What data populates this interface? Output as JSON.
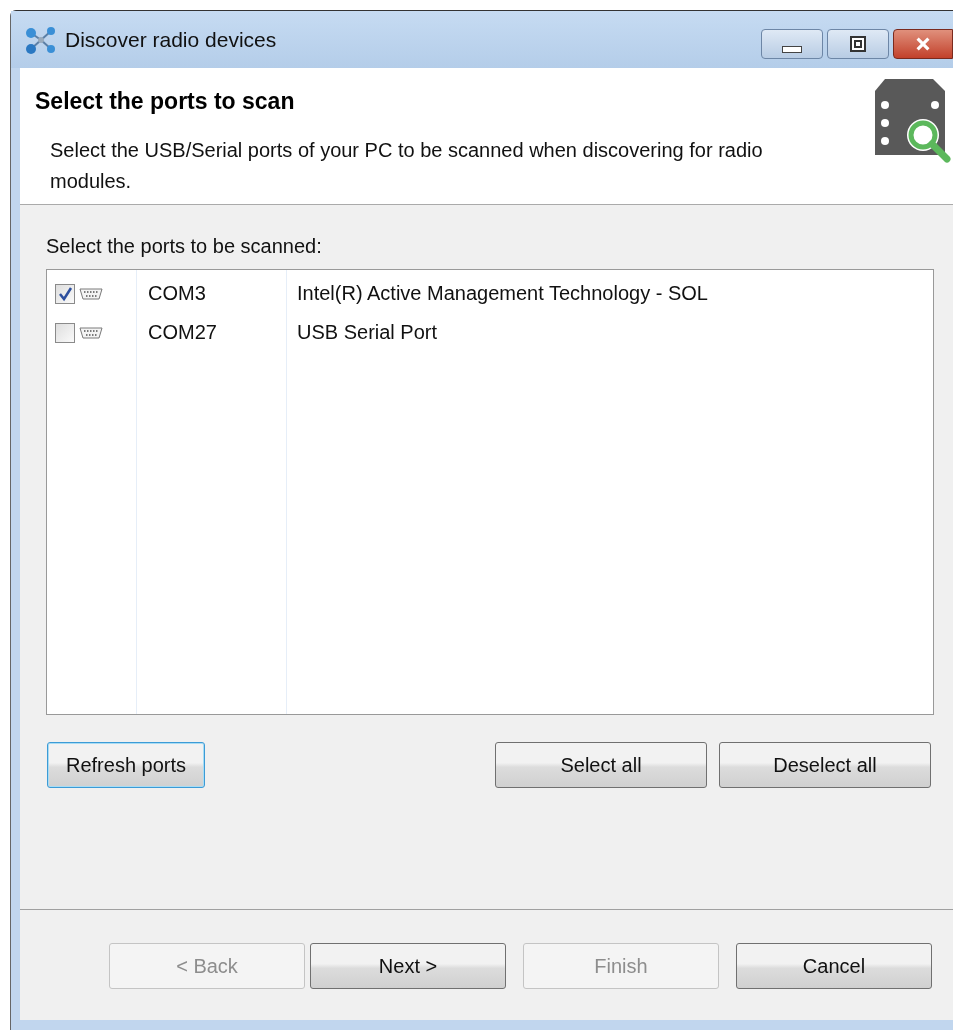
{
  "window": {
    "title": "Discover radio devices"
  },
  "header": {
    "title": "Select the ports to scan",
    "description": "Select the USB/Serial ports of your PC to be scanned when discovering for radio modules."
  },
  "ports_label": "Select the ports to be scanned:",
  "ports": [
    {
      "checked": true,
      "port": "COM3",
      "description": "Intel(R) Active Management Technology - SOL"
    },
    {
      "checked": false,
      "port": "COM27",
      "description": "USB Serial Port"
    }
  ],
  "refresh_button": {
    "label": "Refresh ports",
    "focused": true
  },
  "selection_buttons": [
    {
      "label": "Select all",
      "focused": false
    },
    {
      "label": "Deselect all",
      "focused": false
    }
  ],
  "wizard_buttons": [
    {
      "label": "< Back",
      "disabled": true
    },
    {
      "label": "Next >",
      "disabled": false
    },
    {
      "label": "Finish",
      "disabled": true
    },
    {
      "label": "Cancel",
      "disabled": false
    }
  ]
}
